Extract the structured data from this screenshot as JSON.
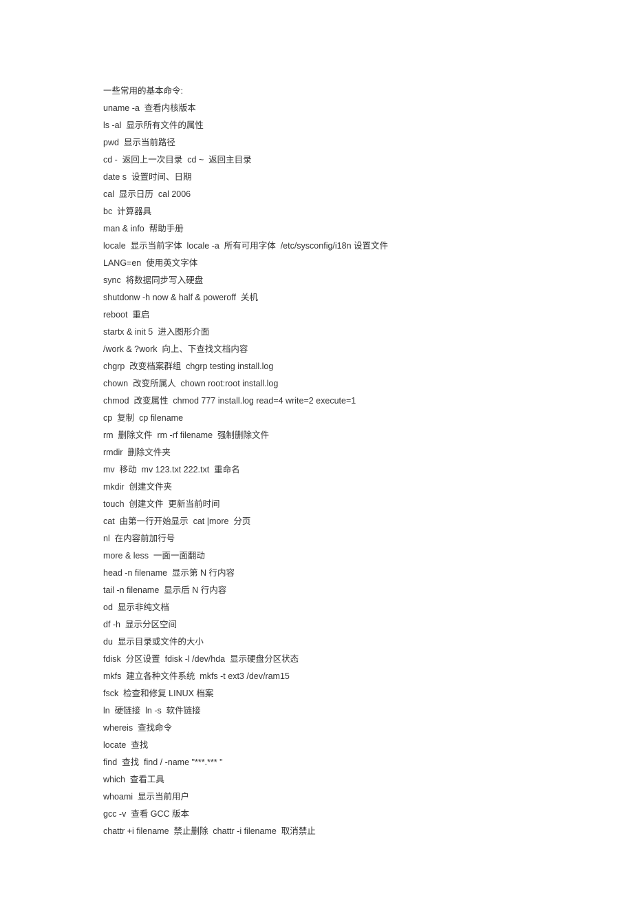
{
  "lines": [
    "一些常用的基本命令:",
    "uname -a  查看内核版本",
    "ls -al  显示所有文件的属性",
    "pwd  显示当前路径",
    "cd -  返回上一次目录  cd ~  返回主目录",
    "date s  设置时间、日期",
    "cal  显示日历  cal 2006",
    "bc  计算器具",
    "man & info  帮助手册",
    "locale  显示当前字体  locale -a  所有可用字体  /etc/sysconfig/i18n 设置文件",
    "LANG=en  使用英文字体",
    "sync  将数据同步写入硬盘",
    "shutdonw -h now & half & poweroff  关机",
    "reboot  重启",
    "startx & init 5  进入图形介面",
    "/work & ?work  向上、下查找文档内容",
    "chgrp  改变档案群组  chgrp testing install.log",
    "chown  改变所属人  chown root:root install.log",
    "chmod  改变属性  chmod 777 install.log read=4 write=2 execute=1",
    "cp  复制  cp filename",
    "rm  删除文件  rm -rf filename  强制删除文件",
    "rmdir  删除文件夹",
    "mv  移动  mv 123.txt 222.txt  重命名",
    "mkdir  创建文件夹",
    "touch  创建文件  更新当前时间",
    "cat  由第一行开始显示  cat |more  分页",
    "nl  在内容前加行号",
    "more & less  一面一面翻动",
    "head -n filename  显示第 N 行内容",
    "tail -n filename  显示后 N 行内容",
    "od  显示非纯文档",
    "df -h  显示分区空间",
    "du  显示目录或文件的大小",
    "fdisk  分区设置  fdisk -l /dev/hda  显示硬盘分区状态",
    "mkfs  建立各种文件系统  mkfs -t ext3 /dev/ram15",
    "fsck  检查和修复 LINUX 档案",
    "ln  硬链接  ln -s  软件链接",
    "whereis  查找命令",
    "locate  查找",
    "find  查找  find / -name \"***.*** \"",
    "which  查看工具",
    "whoami  显示当前用户",
    "gcc -v  查看 GCC 版本",
    "chattr +i filename  禁止删除  chattr -i filename  取消禁止"
  ]
}
